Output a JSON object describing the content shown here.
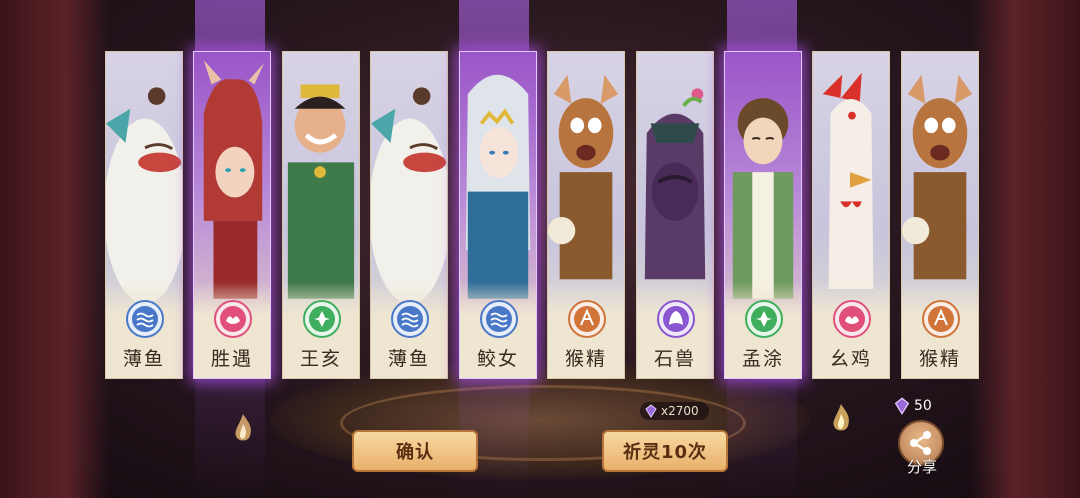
{
  "cards": [
    {
      "name": "薄鱼",
      "element": "water",
      "rarity": "normal"
    },
    {
      "name": "胜遇",
      "element": "fire",
      "rarity": "rare"
    },
    {
      "name": "王亥",
      "element": "wood",
      "rarity": "normal"
    },
    {
      "name": "薄鱼",
      "element": "water",
      "rarity": "normal"
    },
    {
      "name": "鲛女",
      "element": "water",
      "rarity": "rare"
    },
    {
      "name": "猴精",
      "element": "earth",
      "rarity": "normal"
    },
    {
      "name": "石兽",
      "element": "shadow",
      "rarity": "normal"
    },
    {
      "name": "孟涂",
      "element": "wood",
      "rarity": "rare"
    },
    {
      "name": "幺鸡",
      "element": "fire",
      "rarity": "normal"
    },
    {
      "name": "猴精",
      "element": "earth",
      "rarity": "normal"
    }
  ],
  "element_colors": {
    "water": "#4a78c8",
    "fire": "#e0507a",
    "wood": "#3fae5e",
    "earth": "#d0743a",
    "shadow": "#8a55d0"
  },
  "buttons": {
    "confirm_label": "确认",
    "pray_label": "祈灵10次"
  },
  "cost": {
    "icon": "crystal-icon",
    "text": "x2700"
  },
  "currency": {
    "icon": "crystal-icon",
    "amount": "50"
  },
  "share": {
    "icon": "share-icon",
    "label": "分享"
  }
}
